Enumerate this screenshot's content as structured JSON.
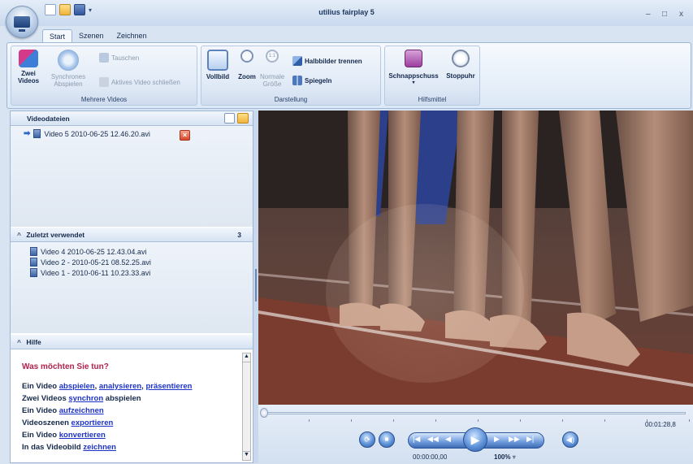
{
  "window": {
    "title": "utilius fairplay 5",
    "controls": [
      "–",
      "□",
      "x"
    ]
  },
  "tabs": [
    "Start",
    "Szenen",
    "Zeichnen"
  ],
  "ribbon": {
    "groups": [
      {
        "label": "Mehrere Videos",
        "buttons": [
          {
            "label": "Zwei Videos",
            "icon": "two-videos-icon",
            "enabled": true
          },
          {
            "label": "Synchrones Abspielen",
            "icon": "sync-icon",
            "enabled": false
          },
          {
            "label": "Tauschen",
            "icon": "swap-icon",
            "enabled": false
          },
          {
            "label": "Aktives Video schließen",
            "icon": "close-video-icon",
            "enabled": false
          }
        ]
      },
      {
        "label": "Darstellung",
        "buttons": [
          {
            "label": "Vollbild",
            "icon": "fullscreen-icon",
            "enabled": true
          },
          {
            "label": "Zoom",
            "icon": "zoom-icon",
            "enabled": true
          },
          {
            "label": "Normale Größe",
            "icon": "normal-size-icon",
            "enabled": false
          },
          {
            "label": "Halbbilder trennen",
            "icon": "split-fields-icon",
            "enabled": true
          },
          {
            "label": "Spiegeln",
            "icon": "mirror-icon",
            "enabled": true
          }
        ]
      },
      {
        "label": "Hilfsmittel",
        "buttons": [
          {
            "label": "Schnappschuss",
            "icon": "camera-icon",
            "enabled": true
          },
          {
            "label": "Stoppuhr",
            "icon": "stopwatch-icon",
            "enabled": true
          }
        ]
      }
    ]
  },
  "videofiles": {
    "header": "Videodateien",
    "items": [
      {
        "name": "Video 5 2010-06-25 12.46.20.avi"
      }
    ]
  },
  "recent": {
    "header": "Zuletzt verwendet",
    "count": "3",
    "items": [
      "Video 4 2010-06-25 12.43.04.avi",
      "Video 2 - 2010-05-21 08.52.25.avi",
      "Video 1 - 2010-06-11 10.23.33.avi"
    ]
  },
  "help": {
    "header": "Hilfe",
    "title": "Was möchten Sie tun?",
    "lines": [
      [
        {
          "t": "Ein Video "
        },
        {
          "l": "abspielen"
        },
        {
          "t": ", "
        },
        {
          "l": "analysieren"
        },
        {
          "t": ", "
        },
        {
          "l": "präsentieren"
        }
      ],
      [
        {
          "t": "Zwei Videos "
        },
        {
          "l": "synchron"
        },
        {
          "t": " abspielen"
        }
      ],
      [
        {
          "t": "Ein Video "
        },
        {
          "l": "aufzeichnen"
        }
      ],
      [
        {
          "t": "Videoszenen "
        },
        {
          "l": "exportieren"
        }
      ],
      [
        {
          "t": "Ein Video "
        },
        {
          "l": "konvertieren"
        }
      ],
      [
        {
          "t": "In das Videobild "
        },
        {
          "l": "zeichnen"
        }
      ]
    ]
  },
  "player": {
    "current_time": "00:00:00,00",
    "duration": "00:01:28,8",
    "zoom": "100%",
    "position_fraction": 0.0
  }
}
